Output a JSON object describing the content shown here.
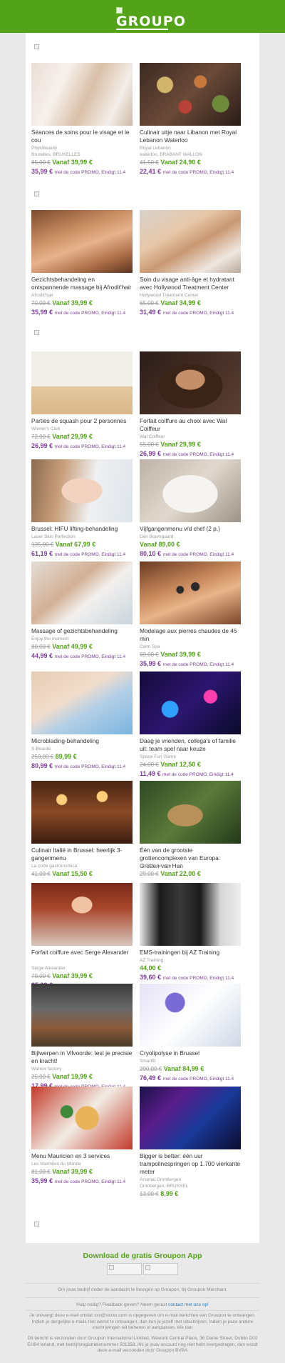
{
  "header": {
    "logo_text": "GROUPO"
  },
  "rows": [
    {
      "banner_before": true,
      "deals": [
        {
          "title": "Séances de soins pour le visage et le cou",
          "merchant": "Phytobeauty",
          "location": "Bruxelles, BRUXELLES",
          "orig": "85,00 €",
          "price": "Vanaf 39,99 €",
          "promo_price": "35,99 €",
          "promo_text": "met de code PROMO, Eindigt 11.4",
          "img": "face-massage"
        },
        {
          "title": "Culinair uitje naar Libanon met Royal Lebanon Waterloo",
          "merchant": "Royal Lebanon",
          "location": "waterloo, BRABANT WALLON",
          "orig": "41,50 €",
          "price": "Vanaf 24,90 €",
          "promo_price": "22,41 €",
          "promo_text": "met de code PROMO, Eindigt 11.4",
          "img": "lebanese-food"
        }
      ]
    },
    {
      "banner_before": true,
      "deals": [
        {
          "title": "Gezichtsbehandeling en ontspannende massage bij Afrodit'hair",
          "merchant": "Afrodit'hair",
          "location": "",
          "orig": "70,00 €",
          "price": "Vanaf 39,99 €",
          "promo_price": "35,99 €",
          "promo_text": "met de code PROMO, Eindigt 11.4",
          "img": "back-massage"
        },
        {
          "title": "Soin du visage anti-âge et hydratant avec Hollywood Treatment Center",
          "merchant": "Hollywood Treatment Center",
          "location": "",
          "orig": "65,00 €",
          "price": "Vanaf 34,99 €",
          "promo_price": "31,49 €",
          "promo_text": "met de code PROMO, Eindigt 11.4",
          "img": "face-treatment"
        }
      ]
    },
    {
      "banner_before": true,
      "deals": [
        {
          "title": "Parties de squash pour 2 personnes",
          "merchant": "Winner's Club",
          "location": "",
          "orig": "72,00 €",
          "price": "Vanaf 29,99 €",
          "promo_price": "26,99 €",
          "promo_text": "met de code PROMO, Eindigt 11.4",
          "img": "squash"
        },
        {
          "title": "Forfait coiffure au choix avec Wal Coiffeur",
          "merchant": "Wal Coiffeur",
          "location": "",
          "orig": "55,00 €",
          "price": "Vanaf 29,99 €",
          "promo_price": "26,99 €",
          "promo_text": "met de code PROMO, Eindigt 11.4",
          "img": "curly-hair"
        }
      ]
    },
    {
      "banner_before": false,
      "deals": [
        {
          "title": "Brussel: HIFU lifting-behandeling",
          "merchant": "Laser Skin Perfection",
          "location": "",
          "orig": "135,00 €",
          "price": "Vanaf 67,99 €",
          "promo_price": "61,19 €",
          "promo_text": "met de code PROMO, Eindigt 11.4",
          "img": "woman-face"
        },
        {
          "title": "Vijfgangenmenu v/d chef (2 p.)",
          "merchant": "Den Boomgaard",
          "location": "",
          "orig": "",
          "price": "Vanaf 89,00 €",
          "promo_price": "80,10 €",
          "promo_text": "met de code PROMO, Eindigt 11.4",
          "img": "plated-dish"
        }
      ]
    },
    {
      "banner_before": false,
      "deals": [
        {
          "title": "Massage of gezichtsbehandeling",
          "merchant": "Enjoy the moment",
          "location": "",
          "orig": "80,00 €",
          "price": "Vanaf 49,99 €",
          "promo_price": "44,99 €",
          "promo_text": "met de code PROMO, Eindigt 11.4",
          "img": "facial-mask"
        },
        {
          "title": "Modelage aux pierres chaudes de 45 min",
          "merchant": "Calm Spa",
          "location": "",
          "orig": "69,00 €",
          "price": "Vanaf 39,99 €",
          "promo_price": "35,99 €",
          "promo_text": "met de code PROMO, Eindigt 11.4",
          "img": "hot-stones"
        }
      ]
    },
    {
      "banner_before": false,
      "deals": [
        {
          "title": "Microblading-behandeling",
          "merchant": "S-Beauté",
          "location": "",
          "orig": "250,00 €",
          "price": "89,99 €",
          "promo_price": "80,99 €",
          "promo_text": "met de code PROMO, Eindigt 11.4",
          "img": "microblading"
        },
        {
          "title": "Daag je vrienden, collega's of familie uit: team spel naar keuze",
          "merchant": "Space Fun Game",
          "location": "",
          "orig": "24,00 €",
          "price": "Vanaf 12,50 €",
          "promo_price": "11,49 €",
          "promo_text": "met de code PROMO, Eindigt 11.4",
          "img": "space-game"
        }
      ]
    },
    {
      "banner_before": false,
      "deals": [
        {
          "title": "Culinair Italië in Brussel: heerlijk 3-gangenmenu",
          "merchant": "La corte gastronomica",
          "location": "",
          "orig": "41,00 €",
          "price": "Vanaf 15,50 €",
          "promo_price": "",
          "promo_text": "",
          "img": "italian-restaurant"
        },
        {
          "title": "Één van de grootste grottencomplexen van Europa: Grotten van Han",
          "merchant": "Grottes de Han",
          "location": "",
          "orig": "29,00 €",
          "price": "Vanaf 22,00 €",
          "promo_price": "",
          "promo_text": "",
          "img": "lynx"
        }
      ]
    },
    {
      "banner_before": false,
      "deals": [
        {
          "title": "Forfait coiffure avec Serge Alexander",
          "merchant": "Serge Alexander",
          "location": "",
          "orig": "70,00 €",
          "price": "Vanaf 39,99 €",
          "promo_price": "35,99 €",
          "promo_text": "met de code PROMO, Eindigt 11.4",
          "img": "red-hair"
        },
        {
          "title": "EMS-trainingen bij AZ Training",
          "merchant": "AZ Training",
          "location": "",
          "orig": "",
          "price": "44,00 €",
          "promo_price": "39,60 €",
          "promo_text": "met de code PROMO, Eindigt 11.4",
          "img": "ems-training"
        }
      ]
    },
    {
      "banner_before": false,
      "deals": [
        {
          "title": "Bijlwerpen in Vilvoorde: test je precisie en kracht!",
          "merchant": "Warrior factory",
          "location": "",
          "orig": "25,00 €",
          "price": "Vanaf 19,99 €",
          "promo_price": "17,99 €",
          "promo_text": "met de code PROMO, Eindigt 11.4",
          "img": "axe-hall"
        },
        {
          "title": "Cryolipolyse in Brussel",
          "merchant": "Smartfit",
          "location": "",
          "orig": "200,00 €",
          "price": "Vanaf 84,99 €",
          "promo_price": "76,49 €",
          "promo_text": "met de code PROMO, Eindigt 11.4",
          "img": "cryolipolysis"
        }
      ]
    },
    {
      "banner_before": false,
      "deals": [
        {
          "title": "Menu Mauricien en 3 services",
          "merchant": "Les Marmites du Monde",
          "location": "",
          "orig": "81,00 €",
          "price": "Vanaf 39,99 €",
          "promo_price": "35,99 €",
          "promo_text": "met de code PROMO, Eindigt 11.4",
          "img": "fish-dish"
        },
        {
          "title": "Bigger is better: één uur trampolinespringen op 1.700 vierkante meter",
          "merchant": "Arsenal Grimbergen",
          "location": "Grimbergen, BRUSSEL",
          "orig": "13,00 €",
          "price": "8,99 €",
          "promo_price": "",
          "promo_text": "",
          "img": "trampoline"
        }
      ]
    }
  ],
  "app": {
    "title": "Download de gratis Groupon App"
  },
  "footer": {
    "line1": "Om jouw bedrijf onder de aandacht te brengen op Groupon, bij Groupon Merchant.",
    "help_text": "Hulp nodig? Feedback geven? Neem gerust",
    "help_link": "contact met ons op!",
    "unsubscribe": "Je ontvangt deze e-mail omdat xxx@xxxxx.com is opgegeven om e-mail berichten van Groupon te ontvangen. Indien je dergelijke e-mails niet wenst te ontvangen, dan kun je jezelf met uitschrijven. Indien je jouw andere inschrijvingen wil beheren of aanpassen, klik dan",
    "sender": "Dit bericht is verzonden door Groupon International Limited, Wework Central Place, 36 Dame Street, Dublin D02 EH94 Ierland, met bedrijfsregistratienummer 501358. Als je jouw account nog niet hebt overgedragen, dan wordt deze e-mail verzonden door Groupon BVBA"
  }
}
